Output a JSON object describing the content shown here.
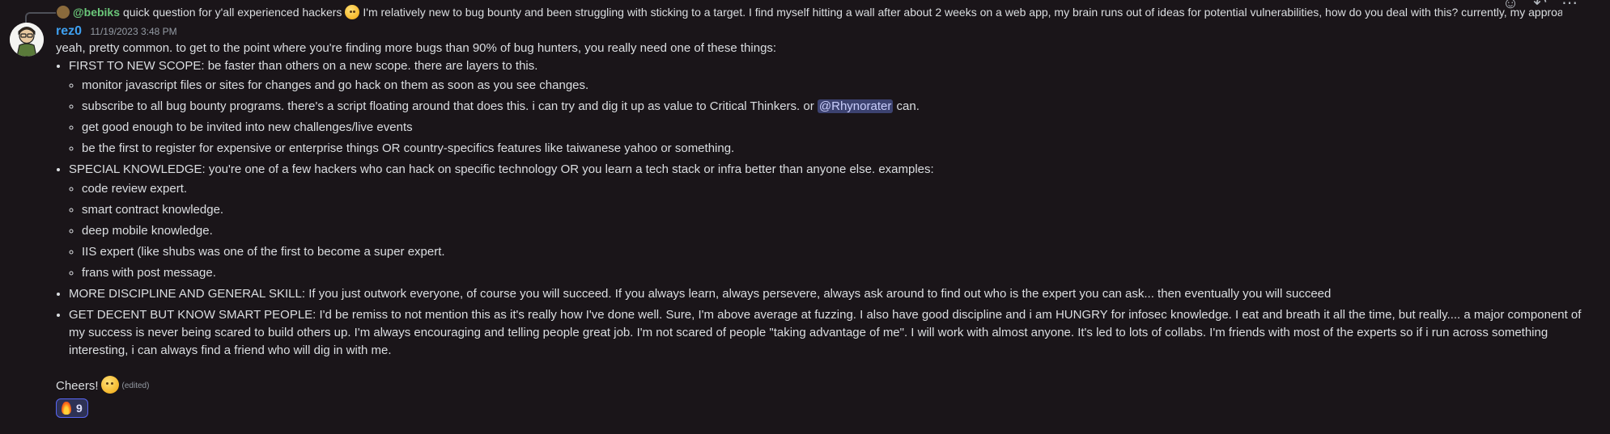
{
  "reply": {
    "author": "@bebiks",
    "text_before": "quick question for y'all experienced hackers",
    "text_after": "I'm relatively new to bug bounty and been struggling with sticking to a target. I find myself hitting a wall after about 2 weeks on a web app, my brain runs out of ideas for potential vulnerabilities, how do you deal with this? currently, my approa"
  },
  "toolbar": {
    "emoji_icon": "☺",
    "reply_icon": "↶",
    "more_icon": "⋯"
  },
  "message": {
    "username": "rez0",
    "timestamp": "11/19/2023 3:48 PM",
    "intro": "yeah, pretty common. to get to the point where you're finding more bugs than 90% of bug hunters, you really need one of these things:",
    "items": [
      {
        "text": "FIRST TO NEW SCOPE: be faster than others on a new scope. there are layers to this.",
        "sub": [
          "monitor javascript files or sites for changes and go hack on them as soon as you see changes.",
          "subscribe to all bug bounty programs. there's a script floating around that does this. i can try and dig it up as value to Critical Thinkers. or",
          "get good enough to be invited into new challenges/live events",
          "be the first to register for expensive or enterprise things OR country-specifics features like taiwanese yahoo or something."
        ],
        "mention": "@Rhynorater",
        "mention_after": "can."
      },
      {
        "text": "SPECIAL KNOWLEDGE: you're one of a few hackers who can hack on specific technology OR you learn a tech stack or infra better than anyone else. examples:",
        "sub": [
          "code review expert.",
          "smart contract knowledge.",
          "deep mobile knowledge.",
          "IIS expert (like shubs was one of the first to become a super expert.",
          "frans with post message."
        ]
      },
      {
        "text": "MORE DISCIPLINE AND GENERAL SKILL: If you just outwork everyone, of course you will succeed. If you always learn, always persevere, always ask around to find out who is the expert you can ask... then eventually you will succeed"
      },
      {
        "text": "GET DECENT BUT KNOW SMART PEOPLE: I'd be remiss to not mention this as it's really how I've done well. Sure, I'm above average at fuzzing. I also have good discipline and i am HUNGRY for infosec knowledge. I eat and breath it all the time, but really.... a major component of my success is never being scared to build others up. I'm always encouraging and telling people great job. I'm not scared of people \"taking advantage of me\". I will work with almost anyone. It's led to lots of collabs. I'm friends with most of the experts so if i run across something interesting, i can always find a friend who will dig in with me."
      }
    ],
    "closing": "Cheers!",
    "edited": "(edited)",
    "reaction": {
      "emoji": "fire-icon",
      "count": "9"
    }
  }
}
